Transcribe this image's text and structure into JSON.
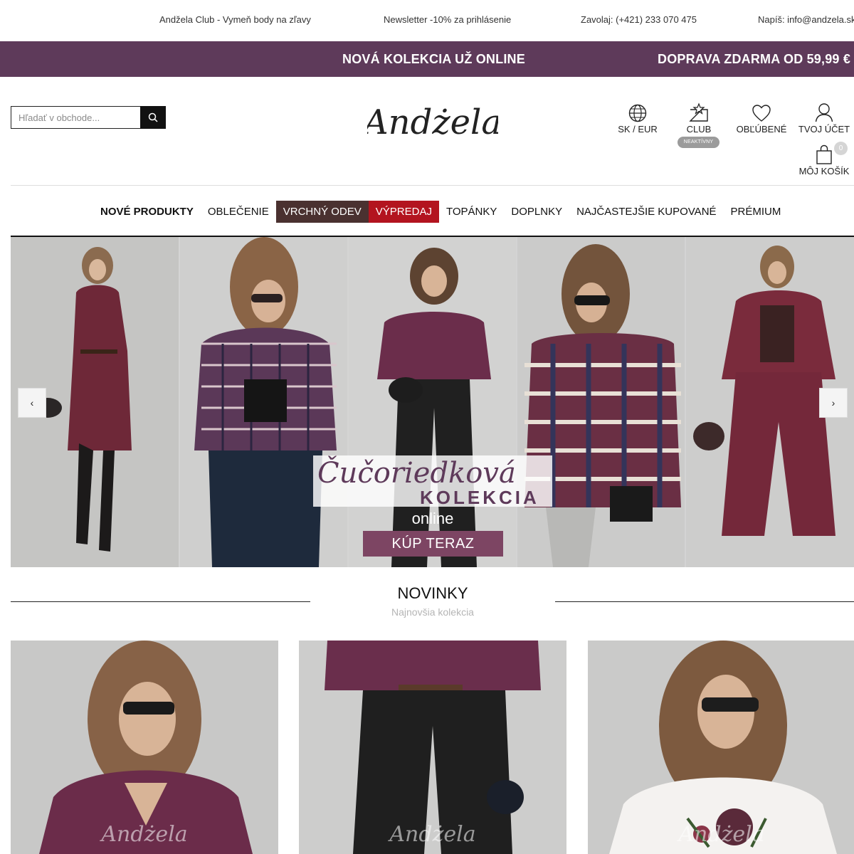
{
  "topbar": {
    "club": "Andžela Club - Vymeň body na zľavy",
    "newsletter": "Newsletter -10% za prihlásenie",
    "phone": "Zavolaj: (+421) 233 070 475",
    "email": "Napíš: info@andzela.sk"
  },
  "promo": {
    "collection": "NOVÁ KOLEKCIA UŽ ONLINE",
    "shipping": "DOPRAVA ZDARMA OD 59,99 €"
  },
  "search": {
    "placeholder": "Hľadať v obchode..."
  },
  "logo": {
    "text": "Andżela"
  },
  "header_icons": {
    "currency": "SK / EUR",
    "club": "CLUB",
    "club_status": "NEAKTÍVNY",
    "favorites": "OBĽÚBENÉ",
    "account": "TVOJ ÚČET",
    "cart": "MÔJ KOŠÍK",
    "cart_count": "0"
  },
  "nav": {
    "items": [
      {
        "label": "NOVÉ PRODUKTY"
      },
      {
        "label": "OBLEČENIE"
      },
      {
        "label": "VRCHNÝ ODEV"
      },
      {
        "label": "VÝPREDAJ"
      },
      {
        "label": "TOPÁNKY"
      },
      {
        "label": "DOPLNKY"
      },
      {
        "label": "NAJČASTEJŠIE KUPOVANÉ"
      },
      {
        "label": "PRÉMIUM"
      }
    ]
  },
  "hero": {
    "script_title": "Čučoriedková",
    "title": "KOLEKCIA",
    "subtitle": "online",
    "cta": "KÚP TERAZ",
    "prev": "‹",
    "next": "›"
  },
  "section": {
    "title": "NOVINKY",
    "subtitle": "Najnovšia kolekcia"
  },
  "products": {
    "watermark": "Andżela"
  },
  "colors": {
    "brand_plum": "#5e3a5a",
    "nav_brown": "#4a3130",
    "nav_red": "#b3141f",
    "cta_plum": "#7d4563"
  }
}
